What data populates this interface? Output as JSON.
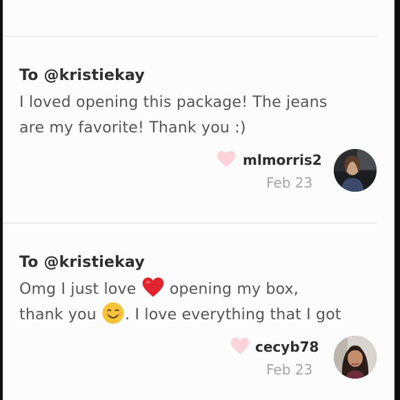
{
  "notes": [
    {
      "to": "To @kristiekay",
      "message_lines": [
        "I loved opening this package! The jeans",
        "are my favorite! Thank you :)"
      ],
      "username": "mlmorris2",
      "date": "Feb 23",
      "avatar_icon": "user-avatar-photo"
    },
    {
      "to": "To @kristiekay",
      "message_parts": {
        "line1_before": "Omg I just love ",
        "line1_emoji": "red-heart-emoji",
        "line1_after": " opening my box,",
        "line2_before": "thank you ",
        "line2_emoji": "smiling-face-emoji",
        "line2_after": ". I love everything that I got"
      },
      "username": "cecyb78",
      "date": "Feb 23",
      "avatar_icon": "user-avatar-photo"
    }
  ],
  "colors": {
    "background": "#fdfcfd",
    "heart_like": "#fbd3d8",
    "username": "#2f2f2f",
    "date": "#a5a5a5",
    "message": "#555555",
    "divider": "#dcdcdc"
  }
}
